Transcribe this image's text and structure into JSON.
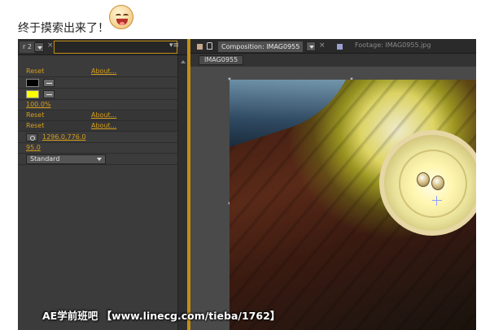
{
  "post": {
    "text": "终于摸索出来了！"
  },
  "effect_panel": {
    "tab_label": "r 2",
    "close_label": "×",
    "menu_label": "▾≡",
    "rows": [
      {
        "reset": "Reset",
        "about": "About..."
      },
      {
        "reset": "Reset",
        "about": "About..."
      },
      {
        "reset": "Reset",
        "about": "About..."
      }
    ],
    "color_1": "#000000",
    "color_2": "#ffff00",
    "percent_value": "100.0%",
    "point_value": "1296.0,776.0",
    "number_value": "95.0",
    "mode_select": "Standard"
  },
  "comp_panel": {
    "composition_tab": "Composition: IMAG0955",
    "close_label": "×",
    "footage_tab": "Footage: IMAG0955.jpg",
    "sub_tab": "IMAG0955",
    "accent_color": "#c28e16"
  },
  "watermark": "AE学前班吧 【www.linecg.com/tieba/1762】"
}
